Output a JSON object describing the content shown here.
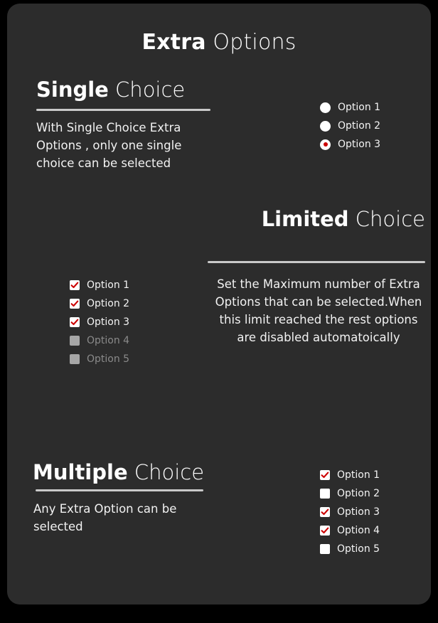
{
  "page": {
    "title_strong": "Extra",
    "title_light": " Options",
    "background_color": "#2c2c2c",
    "page_background_color": "#000000",
    "accent_color": "#cc0000",
    "rule_color": "#c9c9c9",
    "disabled_color": "#8a8a8a"
  },
  "sections": {
    "single": {
      "heading_strong": "Single",
      "heading_light": " Choice",
      "description": "With Single Choice Extra Options ,  only one single choice can be selected",
      "control_type": "radio",
      "options": [
        {
          "label": "Option 1",
          "checked": false,
          "disabled": false
        },
        {
          "label": "Option 2",
          "checked": false,
          "disabled": false
        },
        {
          "label": "Option 3",
          "checked": true,
          "disabled": false
        }
      ]
    },
    "limited": {
      "heading_strong": "Limited",
      "heading_light": " Choice",
      "description": "Set the Maximum number of Extra Options that can be selected.When this limit reached the rest options are disabled automatoically",
      "control_type": "checkbox",
      "options": [
        {
          "label": "Option 1",
          "checked": true,
          "disabled": false
        },
        {
          "label": "Option 2",
          "checked": true,
          "disabled": false
        },
        {
          "label": "Option 3",
          "checked": true,
          "disabled": false
        },
        {
          "label": "Option 4",
          "checked": false,
          "disabled": true
        },
        {
          "label": "Option 5",
          "checked": false,
          "disabled": true
        }
      ]
    },
    "multiple": {
      "heading_strong": "Multiple",
      "heading_light": " Choice",
      "description": "Any Extra Option can be selected",
      "control_type": "checkbox",
      "options": [
        {
          "label": "Option 1",
          "checked": true,
          "disabled": false
        },
        {
          "label": "Option 2",
          "checked": false,
          "disabled": false
        },
        {
          "label": "Option 3",
          "checked": true,
          "disabled": false
        },
        {
          "label": "Option 4",
          "checked": true,
          "disabled": false
        },
        {
          "label": "Option 5",
          "checked": false,
          "disabled": false
        }
      ]
    }
  }
}
